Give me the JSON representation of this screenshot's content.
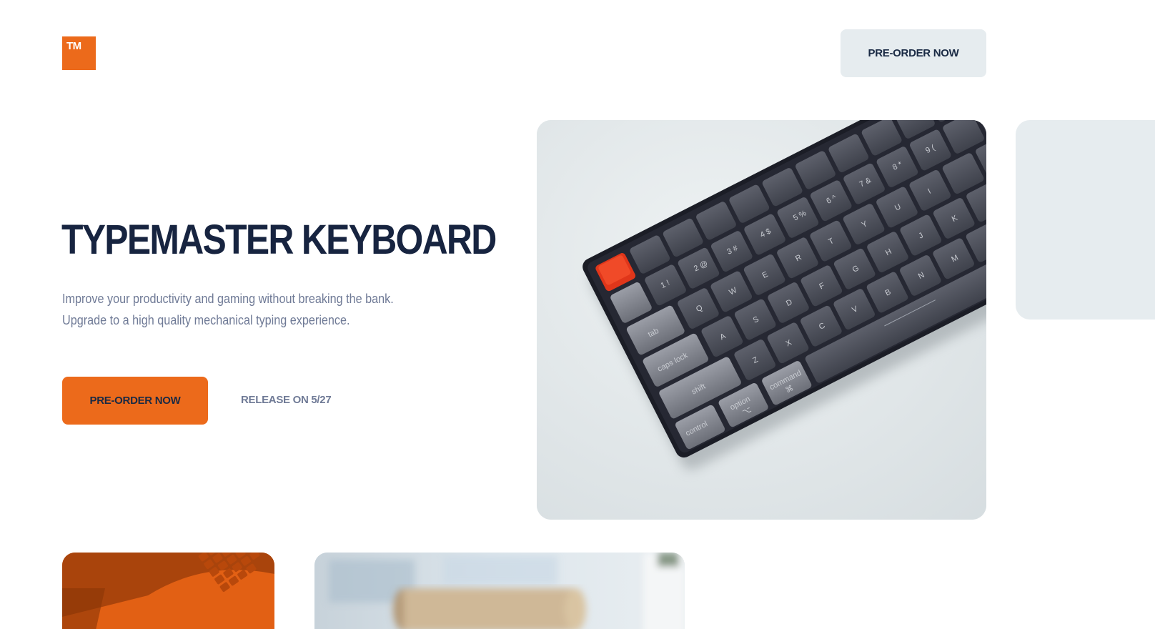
{
  "header": {
    "logo_text": "TM",
    "cta_label": "PRE-ORDER NOW"
  },
  "hero": {
    "title": "TYPEMASTER KEYBOARD",
    "description_line1": "Improve your productivity and gaming without breaking the bank.",
    "description_line2": "Upgrade to a high quality mechanical typing experience.",
    "cta_label": "PRE-ORDER NOW",
    "release_note": "RELEASE ON 5/27"
  },
  "colors": {
    "accent": "#ec6a1b",
    "navy": "#172440",
    "muted": "#6f7a96",
    "light_panel": "#e6ecef",
    "keyboard_case": "#1b1d26",
    "key_dark": "#4b4e5a",
    "key_light": "#8c8f98",
    "escape_key": "#e0361a"
  },
  "keyboard_image": {
    "alt": "Mechanical keyboard",
    "keys": {
      "row1": [
        "☼",
        "☼",
        "▣",
        "▦",
        "☀",
        "☀",
        "◁◁",
        "▷||",
        "▷▷"
      ],
      "row2": [
        "1 !",
        "2 @",
        "3 #",
        "4 $",
        "5 %",
        "6 ^",
        "7 &",
        "8 *",
        "9 ("
      ],
      "row3": [
        "Q",
        "W",
        "E",
        "R",
        "T",
        "Y",
        "U",
        "I"
      ],
      "row4": [
        "A",
        "S",
        "D",
        "F",
        "G",
        "H",
        "J",
        "K"
      ],
      "row5": [
        "Z",
        "X",
        "C",
        "V",
        "B",
        "N",
        "M"
      ],
      "modifiers": [
        "tab",
        "caps lock",
        "shift",
        "control",
        "option ⌥",
        "command ⌘"
      ]
    }
  }
}
